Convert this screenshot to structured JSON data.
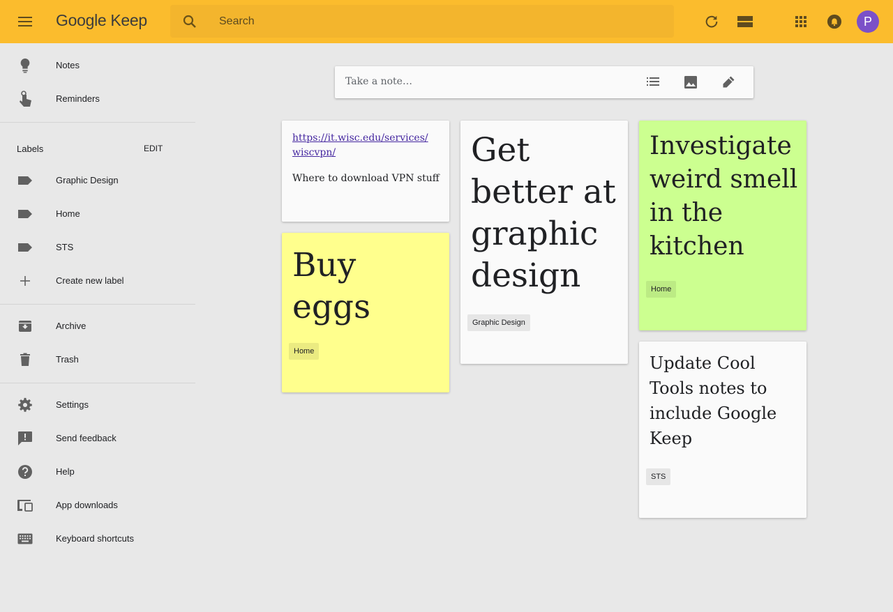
{
  "header": {
    "logo_google": "Google",
    "logo_keep": "Keep",
    "search_placeholder": "Search",
    "avatar_letter": "P"
  },
  "sidebar": {
    "items_top": [
      {
        "label": "Notes",
        "icon": "lightbulb-icon"
      },
      {
        "label": "Reminders",
        "icon": "reminder-hand-icon"
      }
    ],
    "labels_title": "Labels",
    "labels_edit": "EDIT",
    "labels": [
      {
        "label": "Graphic Design",
        "icon": "label-icon"
      },
      {
        "label": "Home",
        "icon": "label-icon"
      },
      {
        "label": "STS",
        "icon": "label-icon"
      }
    ],
    "create_label": "Create new label",
    "items_mid": [
      {
        "label": "Archive",
        "icon": "archive-icon"
      },
      {
        "label": "Trash",
        "icon": "trash-icon"
      }
    ],
    "items_bottom": [
      {
        "label": "Settings",
        "icon": "gear-icon"
      },
      {
        "label": "Send feedback",
        "icon": "feedback-icon"
      },
      {
        "label": "Help",
        "icon": "help-icon"
      },
      {
        "label": "App downloads",
        "icon": "devices-icon"
      },
      {
        "label": "Keyboard shortcuts",
        "icon": "keyboard-icon"
      }
    ]
  },
  "take_note": {
    "placeholder": "Take a note…"
  },
  "notes": [
    {
      "link": "https://it.wisc.edu/services/wiscvpn/",
      "link_line1": "https://it.wisc.edu/services/",
      "link_line2": "wiscvpn/",
      "text": "Where to download VPN stuff",
      "color": "#fafafa"
    },
    {
      "lines": [
        "Buy",
        "eggs"
      ],
      "label": "Home",
      "color": "#ffff8d"
    },
    {
      "lines": [
        "Get",
        "better at",
        "graphic",
        "design"
      ],
      "label": "Graphic Design",
      "color": "#fafafa"
    },
    {
      "lines": [
        "Investigate",
        "weird smell",
        "in the",
        "kitchen"
      ],
      "label": "Home",
      "color": "#ccff90"
    },
    {
      "lines": [
        "Update Cool",
        "Tools notes to",
        "include Google",
        "Keep"
      ],
      "label": "STS",
      "color": "#fafafa"
    }
  ],
  "colors": {
    "header_bg": "#fbbc2d",
    "search_bg": "#f3b52d",
    "page_bg": "#e8e8e8",
    "avatar": "#7b50c8"
  }
}
